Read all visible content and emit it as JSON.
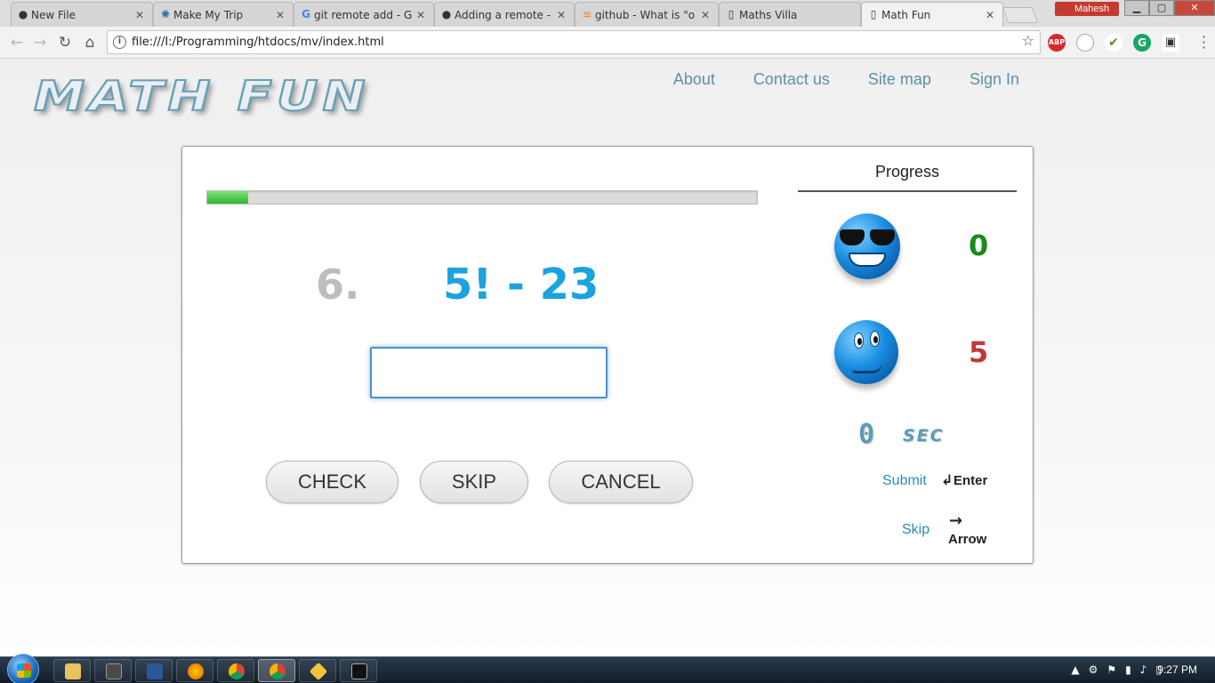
{
  "browser": {
    "tabs": [
      {
        "label": "New File",
        "icon": "github-icon",
        "active": false
      },
      {
        "label": "Make My Trip",
        "icon": "react-icon",
        "active": false
      },
      {
        "label": "git remote add - G",
        "icon": "google-icon",
        "active": false
      },
      {
        "label": "Adding a remote -",
        "icon": "github-icon",
        "active": false
      },
      {
        "label": "github - What is \"o",
        "icon": "stackoverflow-icon",
        "active": false
      },
      {
        "label": "Maths Villa",
        "icon": "page-icon",
        "active": false
      },
      {
        "label": "Math Fun",
        "icon": "page-icon",
        "active": true
      }
    ],
    "profile_name": "Mahesh",
    "url": "file:///I:/Programming/htdocs/mv/index.html",
    "extensions": [
      "ABP",
      "",
      "",
      "G",
      ""
    ]
  },
  "site": {
    "logo": "MATH FUN",
    "nav": [
      "About",
      "Contact us",
      "Site map",
      "Sign In"
    ]
  },
  "quiz": {
    "progress_fraction": 0.075,
    "question_number": "6.",
    "expression": "5! - 23",
    "answer_value": "",
    "buttons": {
      "check": "CHECK",
      "skip": "SKIP",
      "cancel": "CANCEL"
    }
  },
  "sidebar": {
    "title": "Progress",
    "correct_count": "0",
    "wrong_count": "5",
    "correct_color": "#1a8a1a",
    "wrong_color": "#c0393b",
    "timer_value": "0",
    "timer_unit": "SEC",
    "hints": [
      {
        "action": "Submit",
        "glyph": "↲",
        "key": "Enter"
      },
      {
        "action": "Skip",
        "glyph": "→",
        "key": "Arrow"
      }
    ]
  },
  "taskbar": {
    "time": "9:27 PM"
  },
  "colors": {
    "accent_blue": "#1aa3df",
    "nav_link": "#5f8fa7",
    "progress_green": "#2fb82f"
  }
}
